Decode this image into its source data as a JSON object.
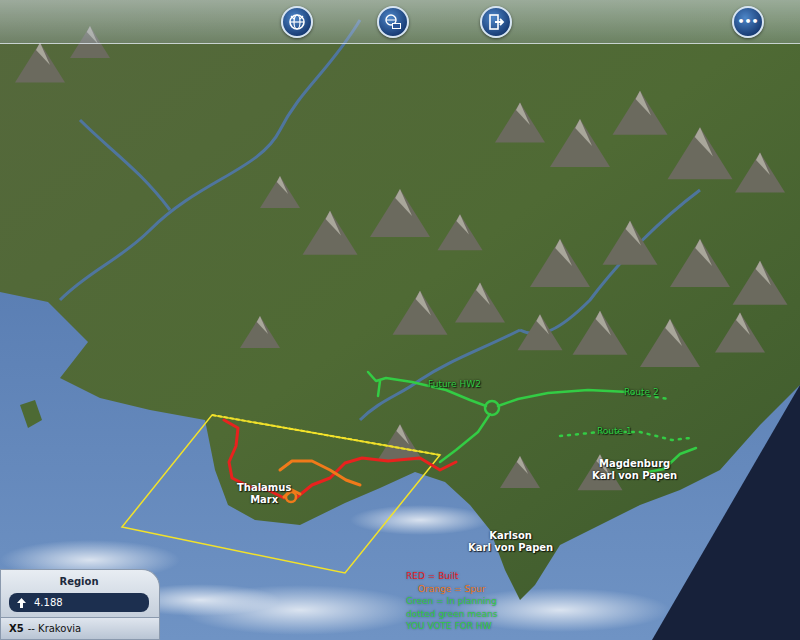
{
  "toolbar": {
    "buttons": [
      {
        "kind": "globe",
        "text": ""
      },
      {
        "kind": "network",
        "text": ""
      },
      {
        "kind": "exit",
        "text": ""
      },
      {
        "kind": "more",
        "text": "•••"
      }
    ]
  },
  "map": {
    "labels": [
      {
        "lines": [
          "Thalamus",
          "Marx"
        ],
        "color": "#ffffff",
        "kind": "city"
      },
      {
        "lines": [
          "Future HW2"
        ],
        "color": "#33cc44",
        "kind": "route"
      },
      {
        "lines": [
          "Route 2"
        ],
        "color": "#33cc44",
        "kind": "route"
      },
      {
        "lines": [
          "Route 1"
        ],
        "color": "#33cc44",
        "kind": "route"
      },
      {
        "lines": [
          "Magdenburg",
          "Karl von Papen"
        ],
        "color": "#ffffff",
        "kind": "city"
      },
      {
        "lines": [
          "Karlson",
          "Karl von Papen"
        ],
        "color": "#ffffff",
        "kind": "city"
      }
    ],
    "routes": [
      {
        "kind": "built",
        "color": "#e8221e",
        "dotted": false
      },
      {
        "kind": "built",
        "color": "#e8221e",
        "dotted": false
      },
      {
        "kind": "spur",
        "color": "#f07a1a",
        "dotted": false
      },
      {
        "kind": "spur",
        "color": "#f07a1a",
        "dotted": false
      },
      {
        "kind": "planning",
        "color": "#33cc44",
        "dotted": false
      },
      {
        "kind": "planning",
        "color": "#33cc44",
        "dotted": false
      },
      {
        "kind": "planning",
        "color": "#33cc44",
        "dotted": true
      },
      {
        "kind": "planning",
        "color": "#33cc44",
        "dotted": false
      },
      {
        "kind": "planning",
        "color": "#33cc44",
        "dotted": false
      },
      {
        "kind": "planning",
        "color": "#33cc44",
        "dotted": true
      },
      {
        "kind": "planning",
        "color": "#33cc44",
        "dotted": false
      }
    ],
    "legend": [
      {
        "text": "RED = Built",
        "color": "#e8221e"
      },
      {
        "text": "Orange = Spur",
        "color": "#f07a1a"
      },
      {
        "text": "Green = In planning",
        "color": "#33cc44"
      },
      {
        "text": "dotted green means",
        "color": "#33cc44"
      },
      {
        "text": "YOU VOTE FOR HW",
        "color": "#33cc44"
      }
    ]
  },
  "region_panel": {
    "title": "Region",
    "population": "4.188",
    "code": "X5",
    "name": "-- Krakovia"
  }
}
